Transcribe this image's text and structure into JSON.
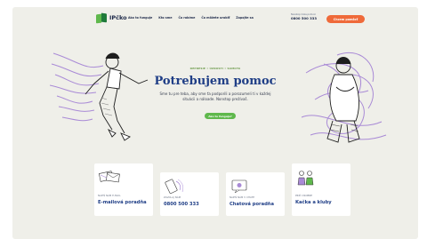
{
  "header": {
    "brand": "IPčko",
    "nav": [
      "Ako to funguje",
      "Kto sme",
      "Čo robíme",
      "Čo môžete urobiť",
      "Zapojte sa"
    ],
    "phone_label": "Nonstop linka pomoci",
    "phone_number": "0800 500 333",
    "cta_label": "Chcem pomôcť"
  },
  "hero": {
    "categories": "DEPRESIE • ÚZKOSTI • SAMOTA",
    "title": "Potrebujem pomoc",
    "text": "Sme tu pre teba, aby sme ťa podporili a porozumeli ti v každej situácii a náloade. Nonstop prežívaš.",
    "button_label": "Ako to funguje?"
  },
  "cards": [
    {
      "label": "NAPÍŠ NÁM E-MAIL",
      "title": "E-mailová poradňa"
    },
    {
      "label": "ZAVOLAJ NÁM",
      "title": "0800 500 333"
    },
    {
      "label": "NAPÍŠ NÁM V CHATE",
      "title": "Chatová poradňa"
    },
    {
      "label": "PRÍĎ OSOBNE",
      "title": "Kačka a kluby"
    }
  ],
  "colors": {
    "page_bg": "#efefe9",
    "primary": "#1f3e86",
    "accent": "#ef6a3a",
    "green": "#5fb84c",
    "lilac": "#a98ad6"
  }
}
